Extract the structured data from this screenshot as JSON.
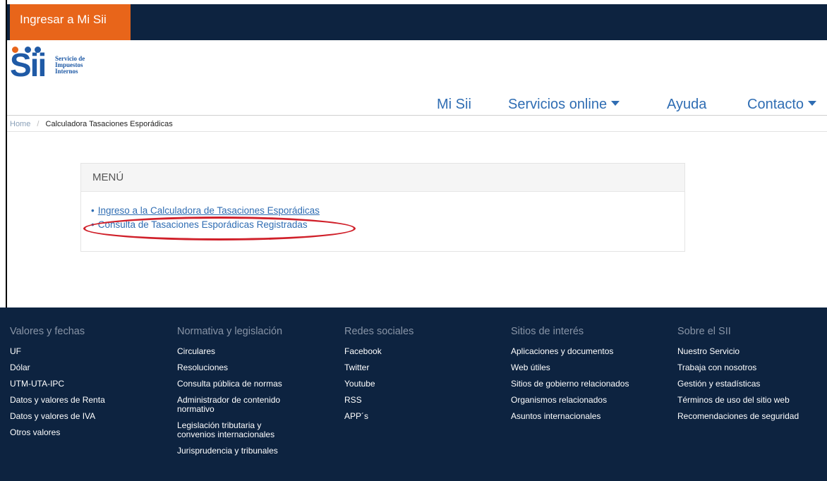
{
  "header": {
    "login_label": "Ingresar a Mi Sii"
  },
  "logo": {
    "wordmark": "Sii",
    "name_line1": "Servicio de",
    "name_line2": "Impuestos",
    "name_line3": "Internos",
    "dot_colors": [
      "#e8651a",
      "#1f5aa6",
      "#1f5aa6"
    ]
  },
  "nav": {
    "items": [
      {
        "label": "Mi Sii",
        "has_caret": false
      },
      {
        "label": "Servicios online",
        "has_caret": true
      },
      {
        "label": "Ayuda",
        "has_caret": false
      },
      {
        "label": "Contacto",
        "has_caret": true
      }
    ]
  },
  "breadcrumb": {
    "home": "Home",
    "separator": "/",
    "current": "Calculadora Tasaciones Esporádicas"
  },
  "menu": {
    "title": "MENÚ",
    "items": [
      {
        "label": "Ingreso a la Calculadora de Tasaciones Esporádicas"
      },
      {
        "label": "Consulta de Tasaciones Esporádicas Registradas"
      }
    ]
  },
  "footer": {
    "columns": [
      {
        "title": "Valores y fechas",
        "links": [
          "UF",
          "Dólar",
          "UTM-UTA-IPC",
          "Datos y valores de Renta",
          "Datos y valores de IVA",
          "Otros valores"
        ]
      },
      {
        "title": "Normativa y legislación",
        "links": [
          "Circulares",
          "Resoluciones",
          "Consulta pública de normas",
          "Administrador de contenido normativo",
          "Legislación tributaria y convenios internacionales",
          "Jurisprudencia y tribunales"
        ]
      },
      {
        "title": "Redes sociales",
        "links": [
          "Facebook",
          "Twitter",
          "Youtube",
          "RSS",
          "APP´s"
        ]
      },
      {
        "title": "Sitios de interés",
        "links": [
          "Aplicaciones y documentos",
          "Web útiles",
          "Sitios de gobierno relacionados",
          "Organismos relacionados",
          "Asuntos internacionales"
        ]
      },
      {
        "title": "Sobre el SII",
        "links": [
          "Nuestro Servicio",
          "Trabaja con nosotros",
          "Gestión y estadísticas",
          "Términos de uso del sitio web",
          "Recomendaciones de seguridad"
        ]
      }
    ]
  },
  "colors": {
    "navy": "#0d2340",
    "orange": "#e8651a",
    "link_blue": "#2f6db3",
    "annotation_red": "#d0202a"
  }
}
